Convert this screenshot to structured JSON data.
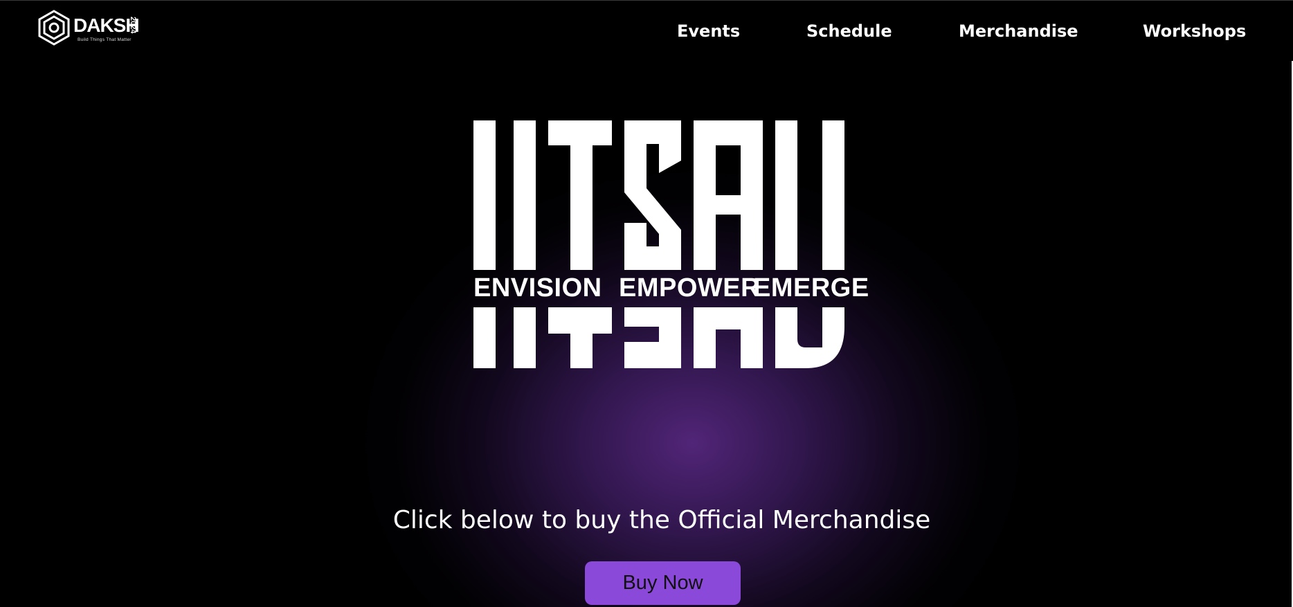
{
  "brand": {
    "wordmark": "DAKSH",
    "year": "2024",
    "tagline": "Build Things That Matter"
  },
  "nav": {
    "items": [
      {
        "label": "Events"
      },
      {
        "label": "Schedule"
      },
      {
        "label": "Merchandise"
      },
      {
        "label": "Workshops"
      }
    ]
  },
  "hero": {
    "title": "UTSAV",
    "tagline": [
      "ENVISION",
      "EMPOWER",
      "EMERGE"
    ]
  },
  "cta": {
    "text": "Click below to buy the Official Merchandise",
    "button_label": "Buy Now"
  },
  "colors": {
    "background": "#000000",
    "accent": "#8a49d8",
    "glow": "#582882",
    "text": "#ffffff"
  }
}
